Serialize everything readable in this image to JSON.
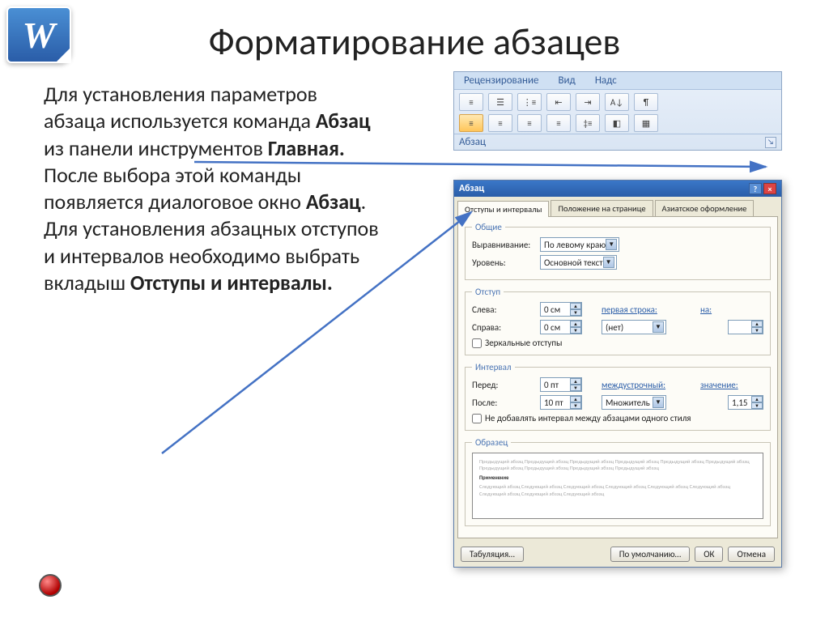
{
  "title": "Форматирование абзацев",
  "body_parts": {
    "p1": "Для установления параметров абзаца используется команда ",
    "b1": "Абзац",
    "p2": " из панели инструментов ",
    "b2": "Главная.",
    "p3": " После выбора этой команды появляется диалоговое окно ",
    "b3": "Абзац",
    "p4": ". Для установления абзацных отступов и интервалов необходимо выбрать вкладыш ",
    "b4": "Отступы и интервалы."
  },
  "ribbon": {
    "tabs": {
      "t1": "Рецензирование",
      "t2": "Вид",
      "t3": "Надс"
    },
    "group_label": "Абзац"
  },
  "dialog": {
    "title": "Абзац",
    "tabs": {
      "t1": "Отступы и интервалы",
      "t2": "Положение на странице",
      "t3": "Азиатское оформление"
    },
    "general": {
      "legend": "Общие",
      "align_label": "Выравнивание:",
      "align_value": "По левому краю",
      "level_label": "Уровень:",
      "level_value": "Основной текст"
    },
    "indent": {
      "legend": "Отступ",
      "left_label": "Слева:",
      "left_value": "0 см",
      "right_label": "Справа:",
      "right_value": "0 см",
      "first_label": "первая строка:",
      "first_value": "(нет)",
      "by_label": "на:",
      "mirror": "Зеркальные отступы"
    },
    "spacing": {
      "legend": "Интервал",
      "before_label": "Перед:",
      "before_value": "0 пт",
      "after_label": "После:",
      "after_value": "10 пт",
      "line_label": "междустрочный:",
      "line_value": "Множитель",
      "val_label": "значение:",
      "val_value": "1,15",
      "nosame": "Не добавлять интервал между абзацами одного стиля"
    },
    "sample": {
      "legend": "Образец",
      "text1": "Предыдущий абзац Предыдущий абзац Предыдущий абзац Предыдущий абзац Предыдущий абзац Предыдущий абзац Предыдущий абзац Предыдущий абзац Предыдущий абзац Предыдущий абзац",
      "text2": "Применение",
      "text3": "Следующий абзац Следующий абзац Следующий абзац Следующий абзац Следующий абзац Следующий абзац Следующий абзац Следующий абзац Следующий абзац"
    },
    "buttons": {
      "tabs": "Табуляция…",
      "default": "По умолчанию…",
      "ok": "ОК",
      "cancel": "Отмена"
    }
  }
}
